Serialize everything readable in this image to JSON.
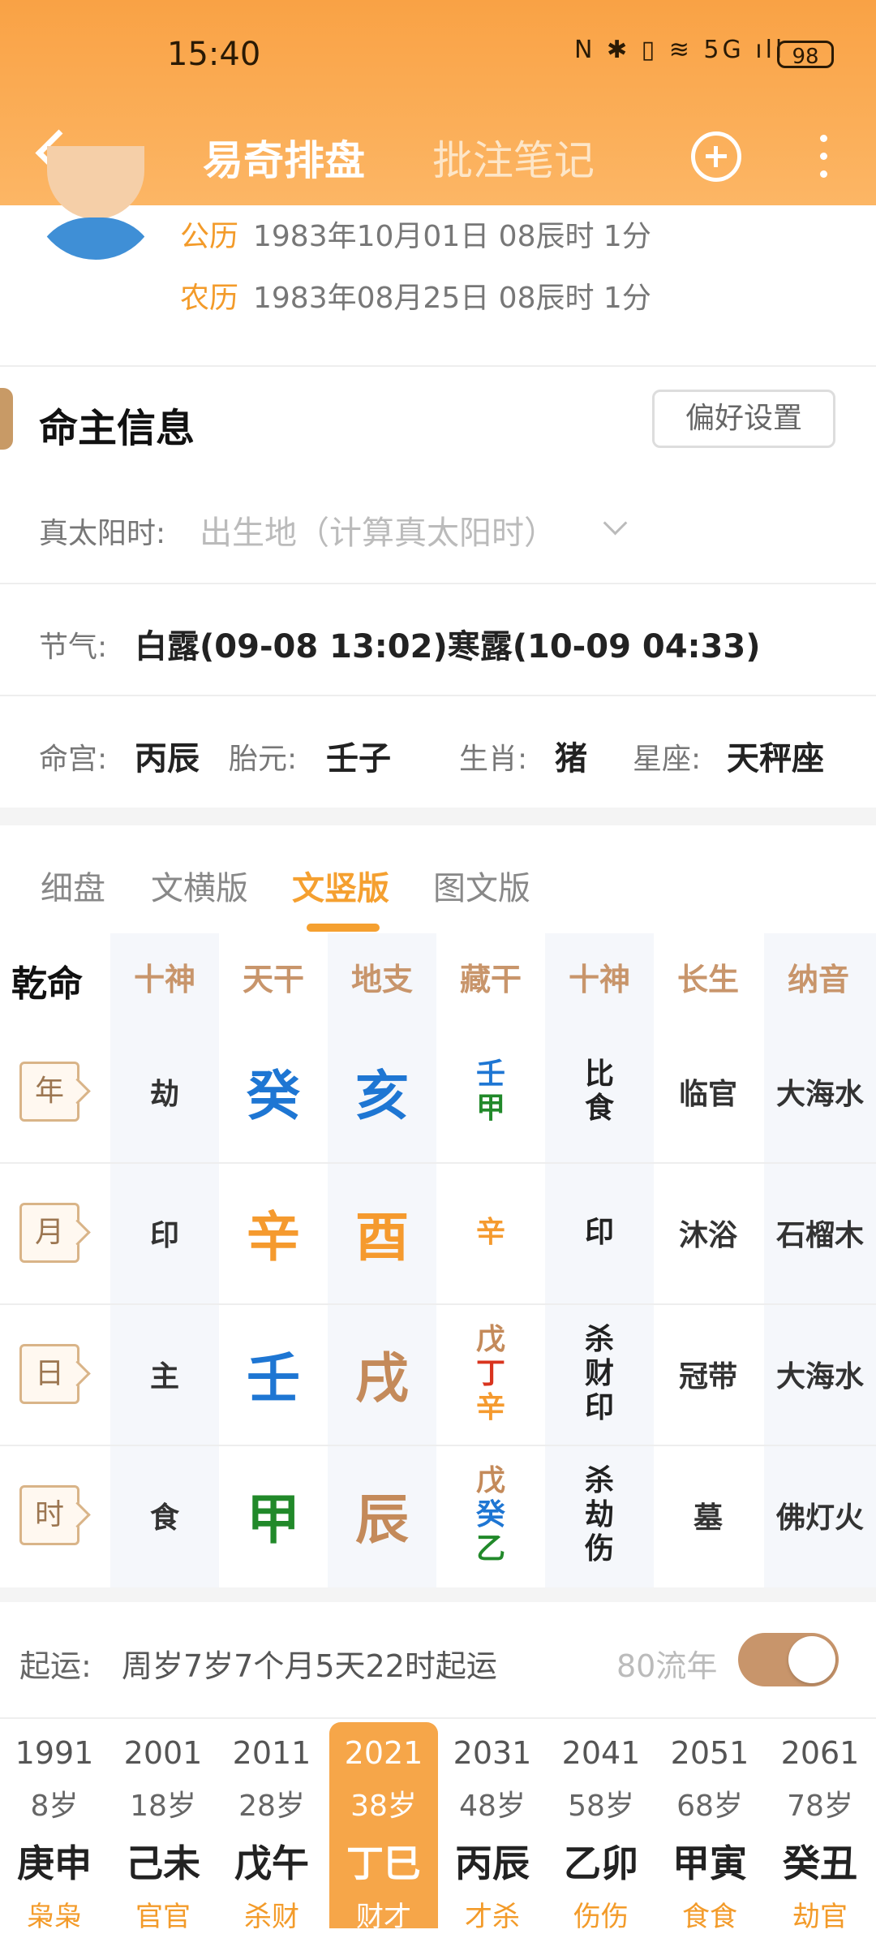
{
  "status_bar": {
    "time": "15:40",
    "icons_text": "N ✱ ▯ ≋ 5G ıll",
    "battery": "98"
  },
  "nav": {
    "tab_active": "易奇排盘",
    "tab_other": "批注笔记"
  },
  "profile": {
    "solar_label": "公历",
    "solar_value": "1983年10月01日 08辰时 1分",
    "lunar_label": "农历",
    "lunar_value": "1983年08月25日 08辰时 1分"
  },
  "info": {
    "title": "命主信息",
    "pref_button": "偏好设置",
    "true_solar_label": "真太阳时:",
    "true_solar_placeholder": "出生地（计算真太阳时）",
    "jieqi_label": "节气:",
    "jieqi_value": "白露(09-08 13:02)寒露(10-09 04:33)",
    "minggong_label": "命宫:",
    "minggong_value": "丙辰",
    "taiyuan_label": "胎元:",
    "taiyuan_value": "壬子",
    "shengxiao_label": "生肖:",
    "shengxiao_value": "猪",
    "xingzuo_label": "星座:",
    "xingzuo_value": "天秤座"
  },
  "view_tabs": [
    "细盘",
    "文横版",
    "文竖版",
    "图文版"
  ],
  "grid": {
    "corner": "乾命",
    "headers": [
      "十神",
      "天干",
      "地支",
      "藏干",
      "十神",
      "长生",
      "纳音"
    ],
    "rows": [
      {
        "label": "年",
        "shishen": "劫",
        "tiangan": "癸",
        "dizhi": "亥",
        "canggan": [
          "壬",
          "甲"
        ],
        "shishen2": [
          "比",
          "食"
        ],
        "changsheng": "临官",
        "nayin": "大海水"
      },
      {
        "label": "月",
        "shishen": "印",
        "tiangan": "辛",
        "dizhi": "酉",
        "canggan": [
          "辛"
        ],
        "shishen2": [
          "印"
        ],
        "changsheng": "沐浴",
        "nayin": "石榴木"
      },
      {
        "label": "日",
        "shishen": "主",
        "tiangan": "壬",
        "dizhi": "戌",
        "canggan": [
          "戊",
          "丁",
          "辛"
        ],
        "shishen2": [
          "杀",
          "财",
          "印"
        ],
        "changsheng": "冠带",
        "nayin": "大海水"
      },
      {
        "label": "时",
        "shishen": "食",
        "tiangan": "甲",
        "dizhi": "辰",
        "canggan": [
          "戊",
          "癸",
          "乙"
        ],
        "shishen2": [
          "杀",
          "劫",
          "伤"
        ],
        "changsheng": "墓",
        "nayin": "佛灯火"
      }
    ]
  },
  "qiyun": {
    "label": "起运:",
    "value": "周岁7岁7个月5天22时起运",
    "liunian_label": "80流年"
  },
  "luck": [
    {
      "year": "1991",
      "age": "8岁",
      "ganzhi": "庚申",
      "tengods": "枭枭"
    },
    {
      "year": "2001",
      "age": "18岁",
      "ganzhi": "己未",
      "tengods": "官官"
    },
    {
      "year": "2011",
      "age": "28岁",
      "ganzhi": "戊午",
      "tengods": "杀财"
    },
    {
      "year": "2021",
      "age": "38岁",
      "ganzhi": "丁巳",
      "tengods": "财才"
    },
    {
      "year": "2031",
      "age": "48岁",
      "ganzhi": "丙辰",
      "tengods": "才杀"
    },
    {
      "year": "2041",
      "age": "58岁",
      "ganzhi": "乙卯",
      "tengods": "伤伤"
    },
    {
      "year": "2051",
      "age": "68岁",
      "ganzhi": "甲寅",
      "tengods": "食食"
    },
    {
      "year": "2061",
      "age": "78岁",
      "ganzhi": "癸丑",
      "tengods": "劫官"
    }
  ],
  "colors": {
    "header": "#f9a245",
    "accent": "#f5a030",
    "water": "#1e76d3",
    "wood": "#21892a",
    "metal": "#f59a2e",
    "earth": "#c48a5a",
    "fire": "#d9341e"
  },
  "icons": [
    "back-icon",
    "add-icon",
    "more-icon",
    "chevron-down-icon",
    "toggle-switch"
  ]
}
